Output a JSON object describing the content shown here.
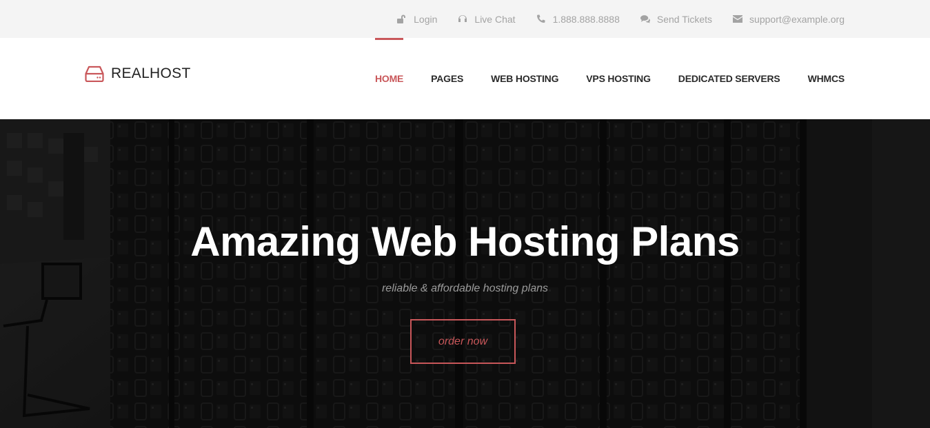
{
  "topbar": {
    "items": [
      {
        "icon": "unlock-icon",
        "label": "Login"
      },
      {
        "icon": "headphones-icon",
        "label": "Live Chat"
      },
      {
        "icon": "phone-icon",
        "label": "1.888.888.8888"
      },
      {
        "icon": "comments-icon",
        "label": "Send Tickets"
      },
      {
        "icon": "envelope-icon",
        "label": "support@example.org"
      }
    ]
  },
  "header": {
    "logo_text": "REALHOST",
    "nav": [
      {
        "label": "HOME",
        "active": true
      },
      {
        "label": "PAGES",
        "active": false
      },
      {
        "label": "WEB HOSTING",
        "active": false
      },
      {
        "label": "VPS HOSTING",
        "active": false
      },
      {
        "label": "DEDICATED SERVERS",
        "active": false
      },
      {
        "label": "WHMCS",
        "active": false
      }
    ]
  },
  "hero": {
    "title": "Amazing Web Hosting Plans",
    "subtitle": "reliable & affordable hosting plans",
    "button_label": "order now"
  },
  "colors": {
    "accent": "#c9575a",
    "topbar_bg": "#f4f4f4",
    "topbar_text": "#a3a3a3",
    "nav_text": "#2a2a2a",
    "hero_bg": "#1a1a1a"
  }
}
